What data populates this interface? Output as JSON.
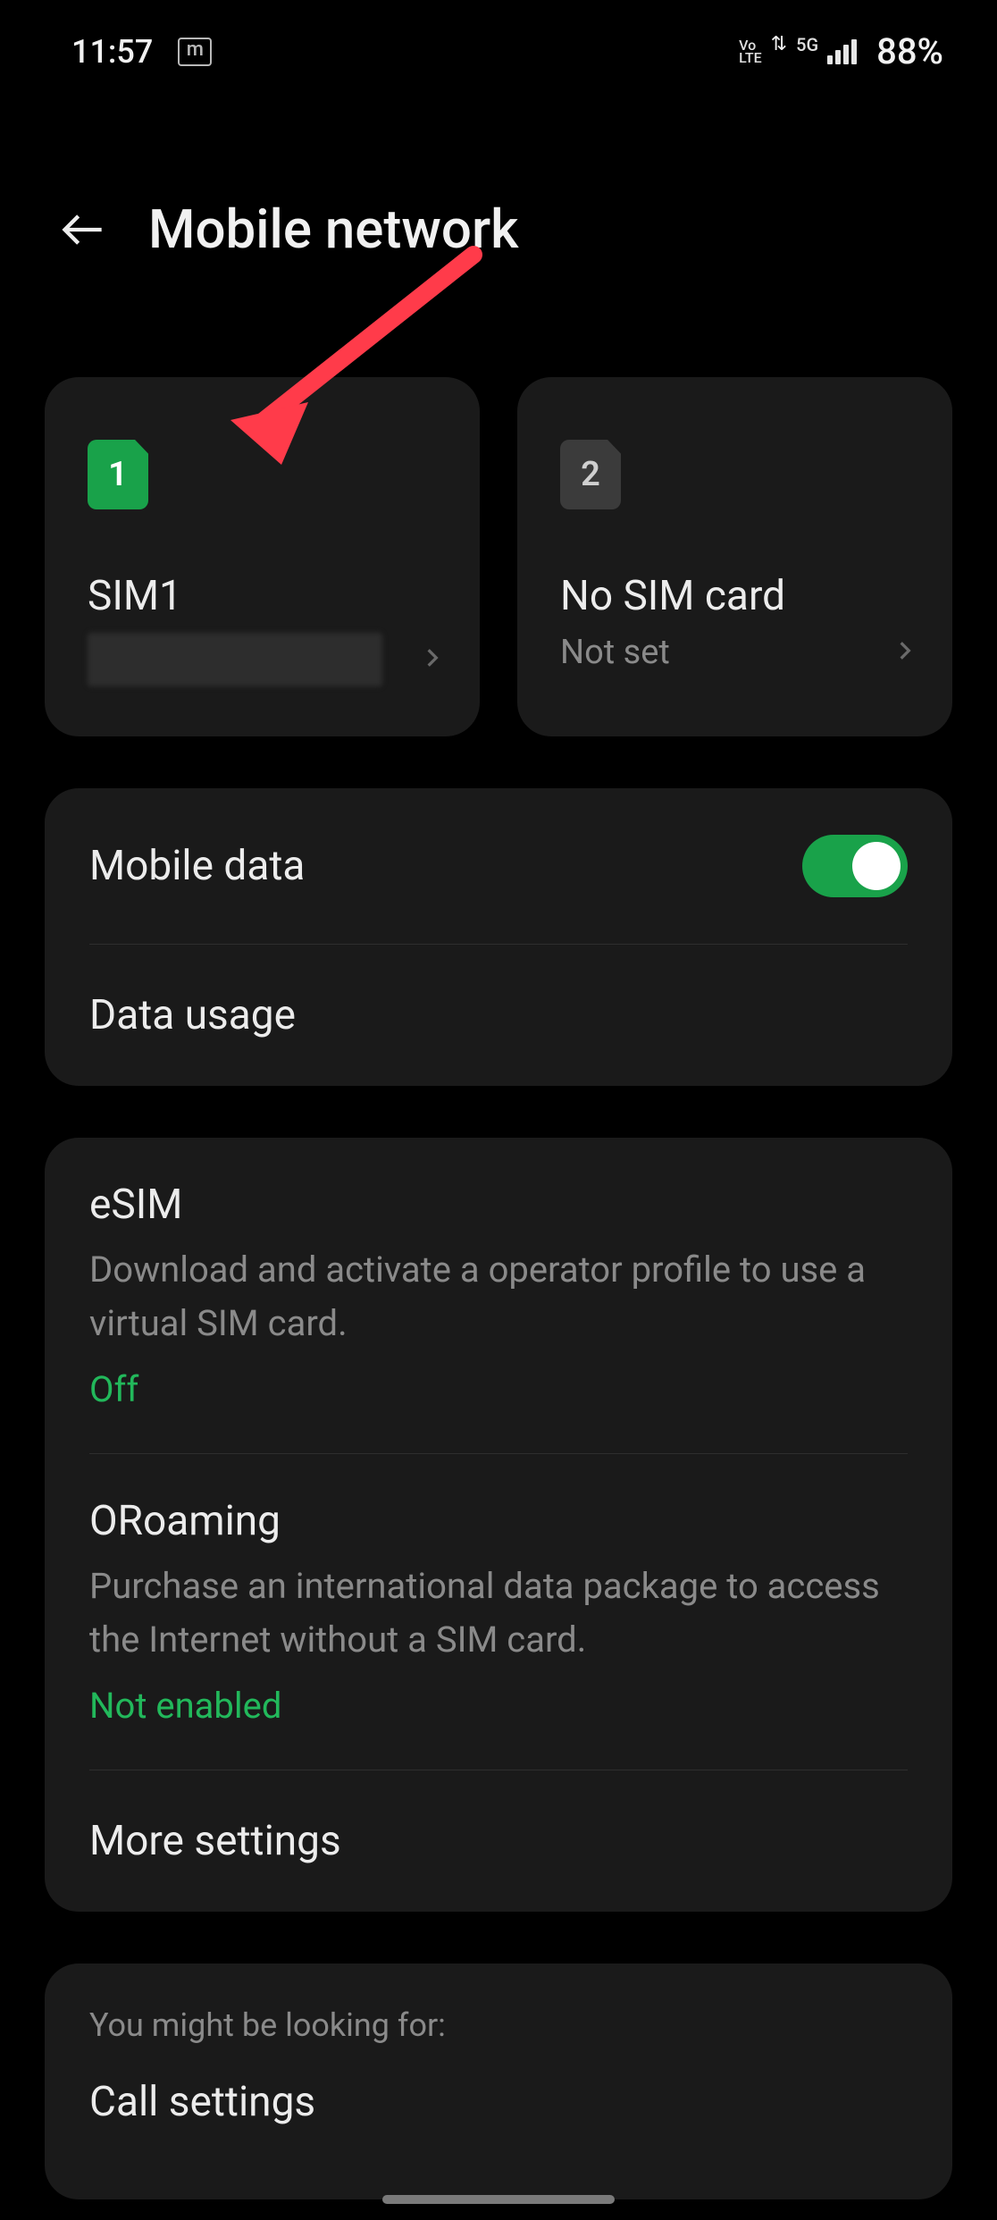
{
  "status_bar": {
    "time": "11:57",
    "volte": "Vo\nLTE",
    "network_type": "5G",
    "battery_pct": "88%"
  },
  "header": {
    "title": "Mobile network"
  },
  "sim_cards": {
    "sim1": {
      "chip_number": "1",
      "name": "SIM1",
      "sub_hidden": true
    },
    "sim2": {
      "chip_number": "2",
      "name": "No SIM card",
      "sub": "Not set"
    }
  },
  "data_section": {
    "mobile_data_label": "Mobile data",
    "mobile_data_on": true,
    "data_usage_label": "Data usage"
  },
  "esim_section": {
    "esim": {
      "title": "eSIM",
      "desc": "Download and activate a operator profile to use a virtual SIM card.",
      "status": "Off"
    },
    "oroaming": {
      "title": "ORoaming",
      "desc": "Purchase an international data package to access the Internet without a SIM card.",
      "status": "Not enabled"
    },
    "more_settings_label": "More settings"
  },
  "suggestions": {
    "heading": "You might be looking for:",
    "call_settings_label": "Call settings"
  },
  "colors": {
    "accent_green": "#19a24a",
    "card_bg": "#1a1a1a",
    "text_secondary": "#8a8a8a"
  }
}
